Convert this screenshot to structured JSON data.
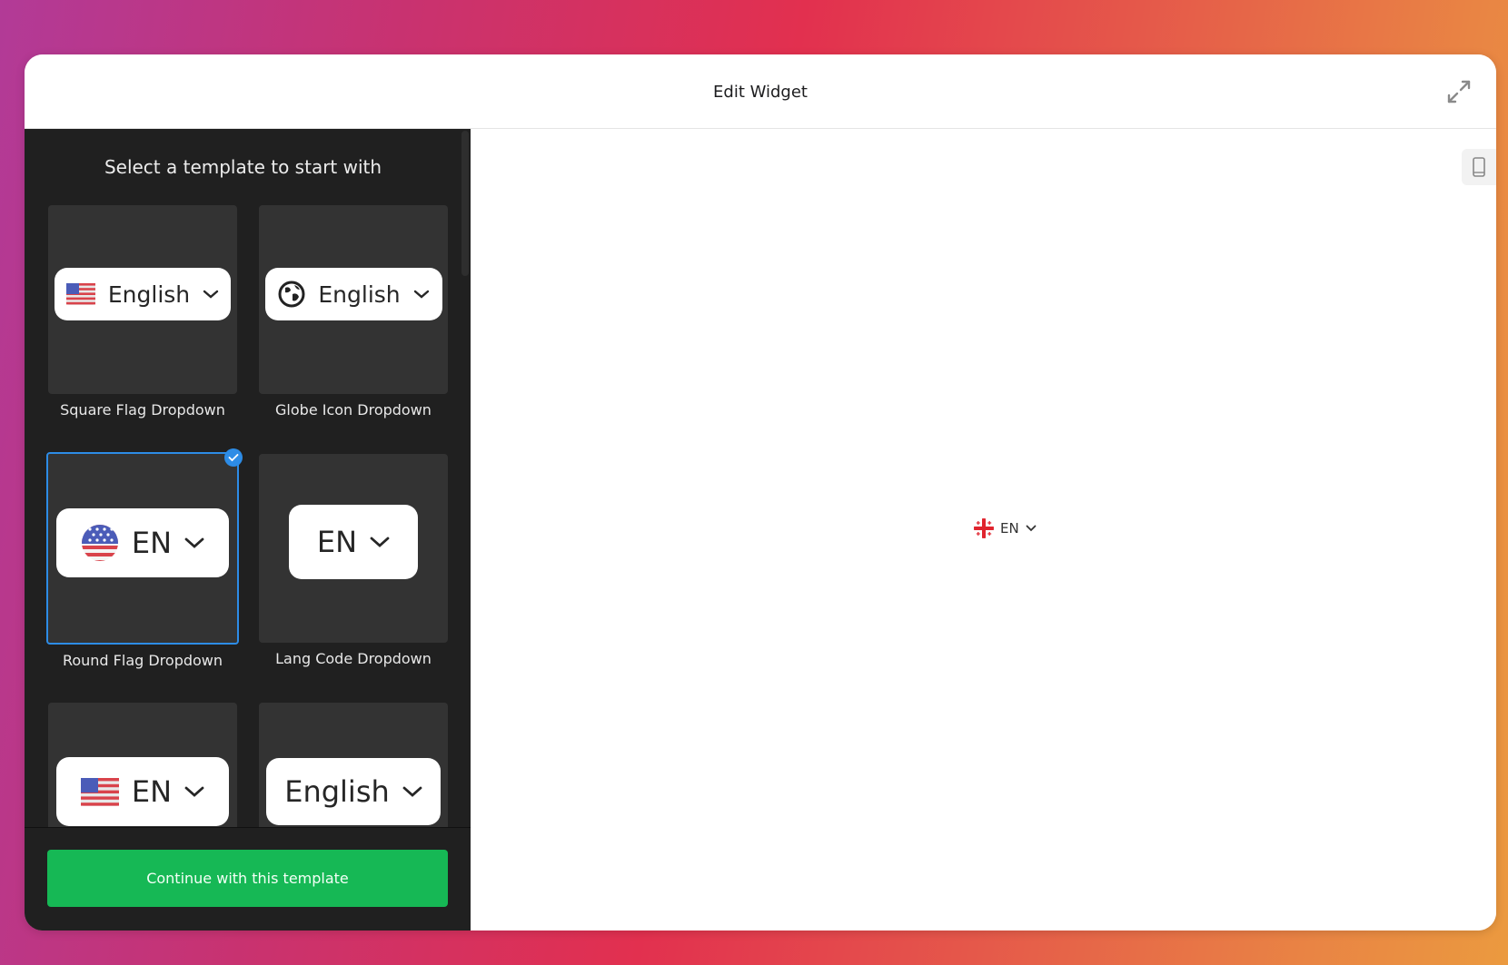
{
  "modal": {
    "title": "Edit Widget",
    "expand_icon": "expand-arrows-icon"
  },
  "left_panel": {
    "title": "Select a template to start with",
    "templates": [
      {
        "label": "Square Flag Dropdown",
        "pill_text": "English",
        "icon": "us-flag-square-icon",
        "selected": false
      },
      {
        "label": "Globe Icon Dropdown",
        "pill_text": "English",
        "icon": "globe-icon",
        "selected": false
      },
      {
        "label": "Round Flag Dropdown",
        "pill_text": "EN",
        "icon": "us-flag-round-icon",
        "selected": true
      },
      {
        "label": "Lang Code Dropdown",
        "pill_text": "EN",
        "icon": null,
        "selected": false
      },
      {
        "label": "",
        "pill_text": "EN",
        "icon": "us-flag-square-icon",
        "selected": false
      },
      {
        "label": "",
        "pill_text": "English",
        "icon": null,
        "selected": false
      }
    ],
    "continue_button": "Continue with this template"
  },
  "preview": {
    "device_icon": "mobile-device-icon",
    "widget": {
      "flag_icon": "round-flag-icon",
      "text": "EN"
    }
  },
  "colors": {
    "accent_blue": "#2d8ce6",
    "continue_green": "#16b855",
    "panel_dark": "#202020",
    "card_bg": "#333333"
  }
}
